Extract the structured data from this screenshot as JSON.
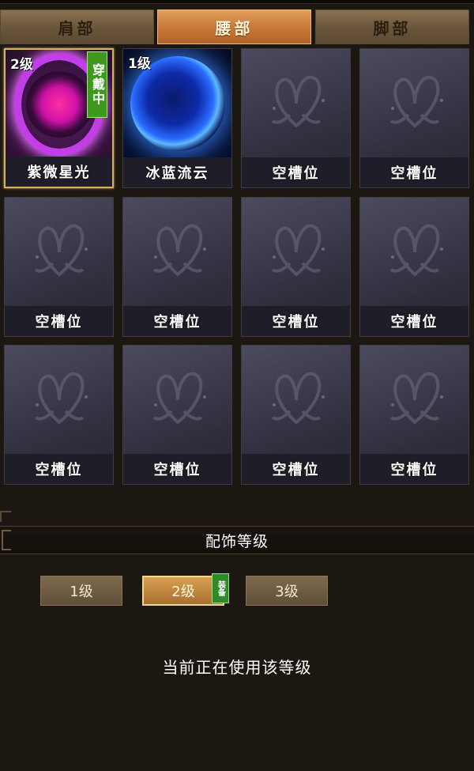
{
  "tabs": [
    {
      "label": "肩部"
    },
    {
      "label": "腰部"
    },
    {
      "label": "脚部"
    }
  ],
  "active_tab": "腰部",
  "slots": [
    {
      "name": "紫微星光",
      "level": "2级",
      "badge": "穿戴中",
      "icon": "pink-orb-icon"
    },
    {
      "name": "冰蓝流云",
      "level": "1级",
      "icon": "blue-orb-icon"
    },
    {
      "name": "空槽位",
      "icon": "butterfly-placeholder-icon"
    },
    {
      "name": "空槽位",
      "icon": "butterfly-placeholder-icon"
    },
    {
      "name": "空槽位",
      "icon": "butterfly-placeholder-icon"
    },
    {
      "name": "空槽位",
      "icon": "butterfly-placeholder-icon"
    },
    {
      "name": "空槽位",
      "icon": "butterfly-placeholder-icon"
    },
    {
      "name": "空槽位",
      "icon": "butterfly-placeholder-icon"
    },
    {
      "name": "空槽位",
      "icon": "butterfly-placeholder-icon"
    },
    {
      "name": "空槽位",
      "icon": "butterfly-placeholder-icon"
    },
    {
      "name": "空槽位",
      "icon": "butterfly-placeholder-icon"
    },
    {
      "name": "空槽位",
      "icon": "butterfly-placeholder-icon"
    }
  ],
  "level_section": {
    "title": "配饰等级",
    "buttons": [
      {
        "label": "1级"
      },
      {
        "label": "2级"
      },
      {
        "label": "3级"
      }
    ],
    "active": "2级",
    "equip_badge": "装备",
    "status": "当前正在使用该等级"
  },
  "colors": {
    "active_tab": "#c97a37",
    "tab": "#6a553a",
    "wearing_badge": "#3d9a1c",
    "selected_border": "#d4b06a"
  }
}
